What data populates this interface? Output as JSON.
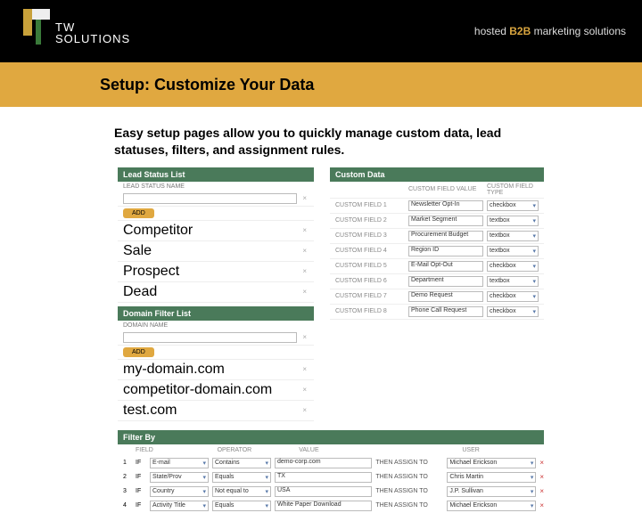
{
  "brand": {
    "line1": "TW",
    "line2": "SOLUTIONS",
    "tagline_lead": "hosted ",
    "tagline_accent": "B2B",
    "tagline_tail": " marketing solutions"
  },
  "title": "Setup: Customize Your Data",
  "lead": "Easy setup pages allow you to quickly manage custom data, lead statuses, filters, and assignment rules.",
  "leadStatus": {
    "heading": "Lead Status List",
    "col": "LEAD STATUS NAME",
    "addLabel": "ADD",
    "items": [
      "Competitor",
      "Sale",
      "Prospect",
      "Dead"
    ]
  },
  "domainFilter": {
    "heading": "Domain Filter List",
    "col": "DOMAIN NAME",
    "addLabel": "ADD",
    "items": [
      "my-domain.com",
      "competitor-domain.com",
      "test.com"
    ]
  },
  "customData": {
    "heading": "Custom Data",
    "col1": "CUSTOM FIELD VALUE",
    "col2": "CUSTOM FIELD TYPE",
    "rows": [
      {
        "label": "CUSTOM FIELD 1",
        "value": "Newsletter Opt-In",
        "type": "checkbox"
      },
      {
        "label": "CUSTOM FIELD 2",
        "value": "Market Segment",
        "type": "textbox"
      },
      {
        "label": "CUSTOM FIELD 3",
        "value": "Procurement Budget",
        "type": "textbox"
      },
      {
        "label": "CUSTOM FIELD 4",
        "value": "Region ID",
        "type": "textbox"
      },
      {
        "label": "CUSTOM FIELD 5",
        "value": "E-Mail Opt-Out",
        "type": "checkbox"
      },
      {
        "label": "CUSTOM FIELD 6",
        "value": "Department",
        "type": "textbox"
      },
      {
        "label": "CUSTOM FIELD 7",
        "value": "Demo Request",
        "type": "checkbox"
      },
      {
        "label": "CUSTOM FIELD 8",
        "value": "Phone Call Request",
        "type": "checkbox"
      }
    ]
  },
  "filterBy": {
    "heading": "Filter By",
    "cols": {
      "field": "FIELD",
      "operator": "OPERATOR",
      "value": "VALUE",
      "user": "USER"
    },
    "assignText": "THEN ASSIGN TO",
    "rows": [
      {
        "n": "1",
        "cond": "IF",
        "field": "E-mail",
        "op": "Contains",
        "value": "demo-corp.com",
        "user": "Michael Erickson"
      },
      {
        "n": "2",
        "cond": "IF",
        "field": "State/Prov",
        "op": "Equals",
        "value": "TX",
        "user": "Chris Martin"
      },
      {
        "n": "3",
        "cond": "IF",
        "field": "Country",
        "op": "Not equal to",
        "value": "USA",
        "user": "J.P. Sullivan"
      },
      {
        "n": "4",
        "cond": "IF",
        "field": "Activity Title",
        "op": "Equals",
        "value": "White Paper Download",
        "user": "Michael Erickson"
      }
    ]
  }
}
